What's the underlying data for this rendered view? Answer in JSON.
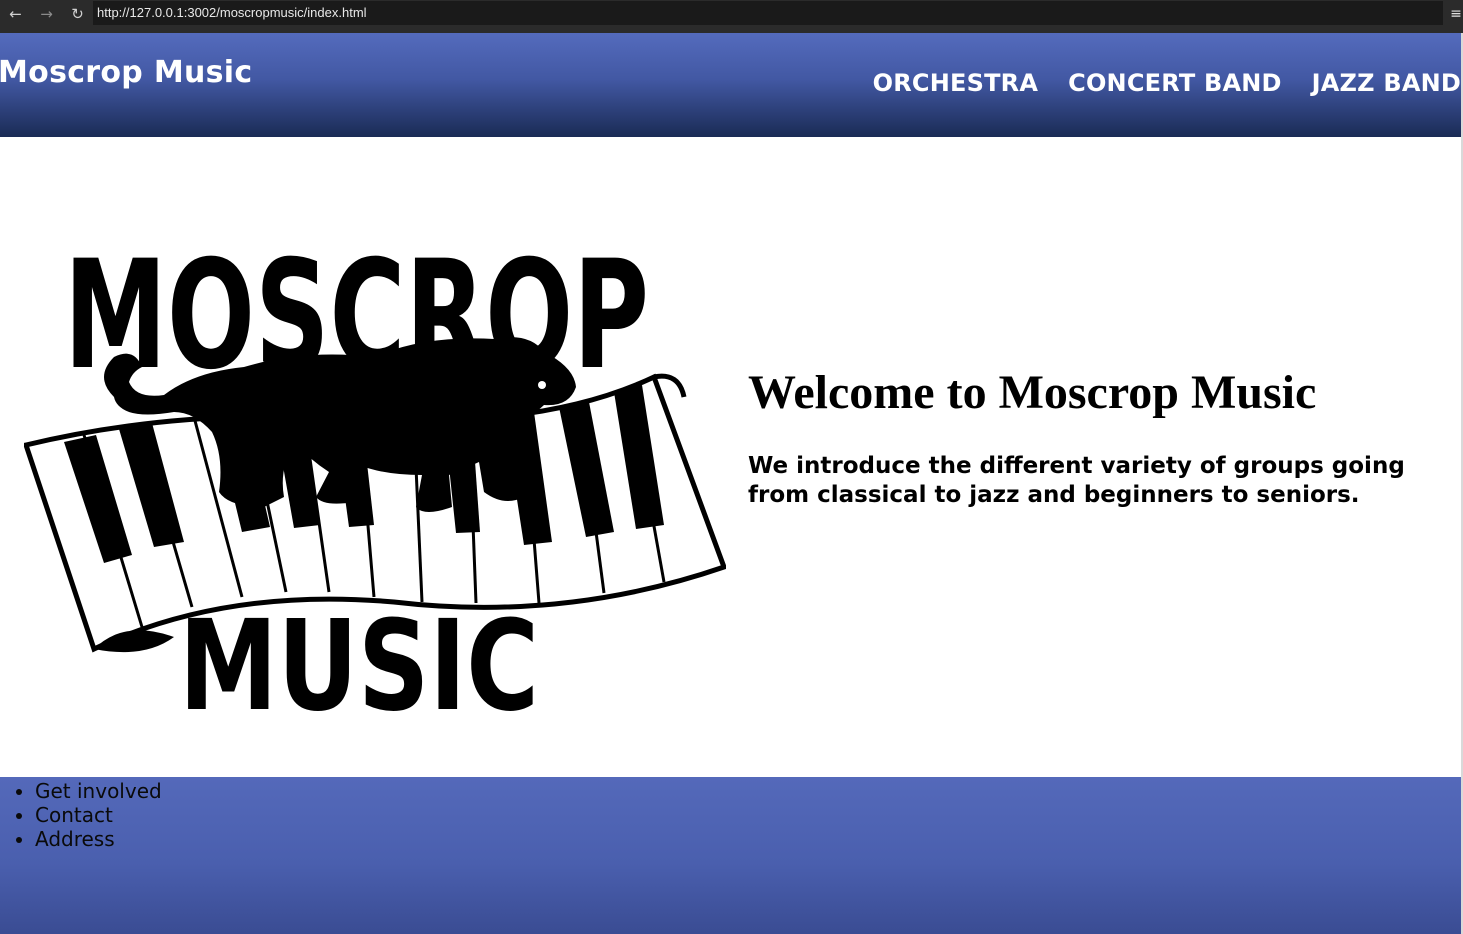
{
  "browser": {
    "url": "http://127.0.0.1:3002/moscropmusic/index.html",
    "back_icon": "arrow-left-icon",
    "forward_icon": "arrow-right-icon",
    "reload_icon": "reload-icon",
    "menu_icon": "hamburger-menu-icon"
  },
  "header": {
    "title": "Moscrop Music",
    "nav": [
      {
        "label": "ORCHESTRA"
      },
      {
        "label": "CONCERT BAND"
      },
      {
        "label": "JAZZ BAND"
      }
    ]
  },
  "hero": {
    "logo": {
      "top_text": "MOSCROP",
      "bottom_text": "MUSIC"
    },
    "welcome_title": "Welcome to Moscrop Music",
    "welcome_subtitle": "We introduce the different variety of groups going from classical to jazz and beginners to seniors."
  },
  "footer": {
    "items": [
      {
        "label": "Get involved"
      },
      {
        "label": "Contact"
      },
      {
        "label": "Address"
      }
    ]
  },
  "colors": {
    "header_top": "#546bbd",
    "header_bottom": "#1a2b55",
    "footer": "#4a5fae",
    "chrome": "#2b2b2b"
  }
}
